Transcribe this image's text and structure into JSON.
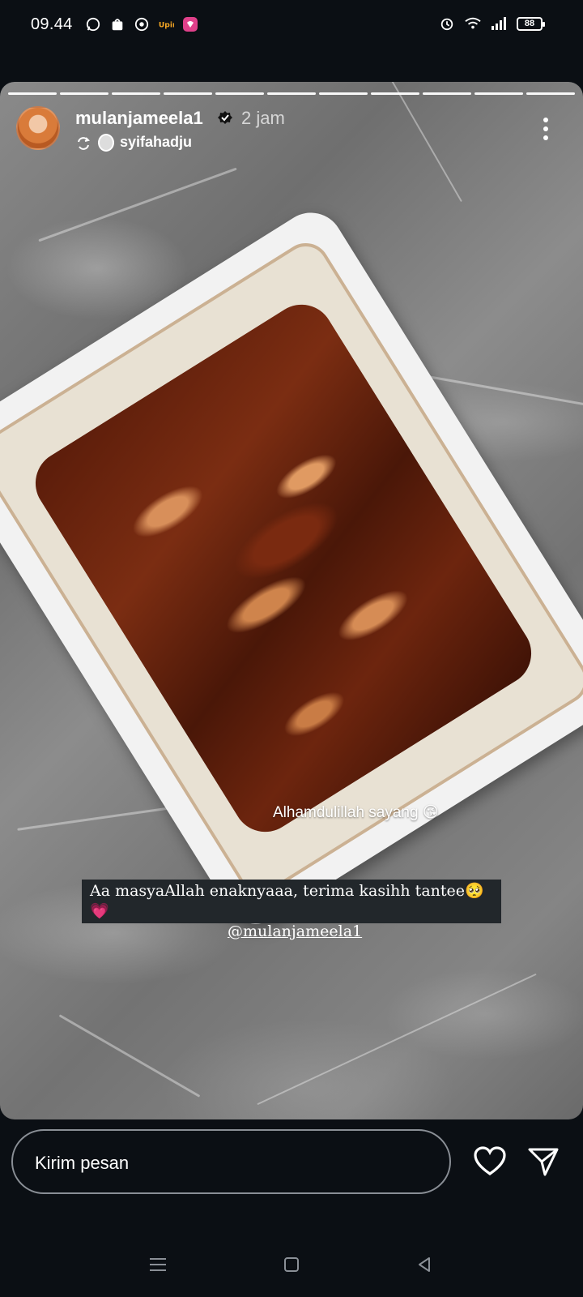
{
  "status_bar": {
    "time": "09.44",
    "battery": "88",
    "left_icons": [
      "whatsapp-icon",
      "shopee-icon",
      "chrome-icon",
      "upin-icon",
      "chat-app-icon"
    ],
    "right_icons": [
      "alarm-icon",
      "wifi-icon",
      "signal-icon",
      "battery-icon"
    ]
  },
  "story": {
    "progress_segments": 11,
    "username": "mulanjameela1",
    "time_ago": "2 jam",
    "reposted_from": "syifahadju",
    "sticker_text": "Alhamdulillah sayang 😘",
    "caption_line1": "Aa masyaAllah enaknyaaa, terima kasihh tantee🥺💗",
    "caption_mention": "@mulanjameela1"
  },
  "reply_bar": {
    "placeholder": "Kirim pesan"
  },
  "colors": {
    "background": "#0b0f14",
    "caption_bg": "#22272b",
    "reply_border": "#8a8f96"
  }
}
